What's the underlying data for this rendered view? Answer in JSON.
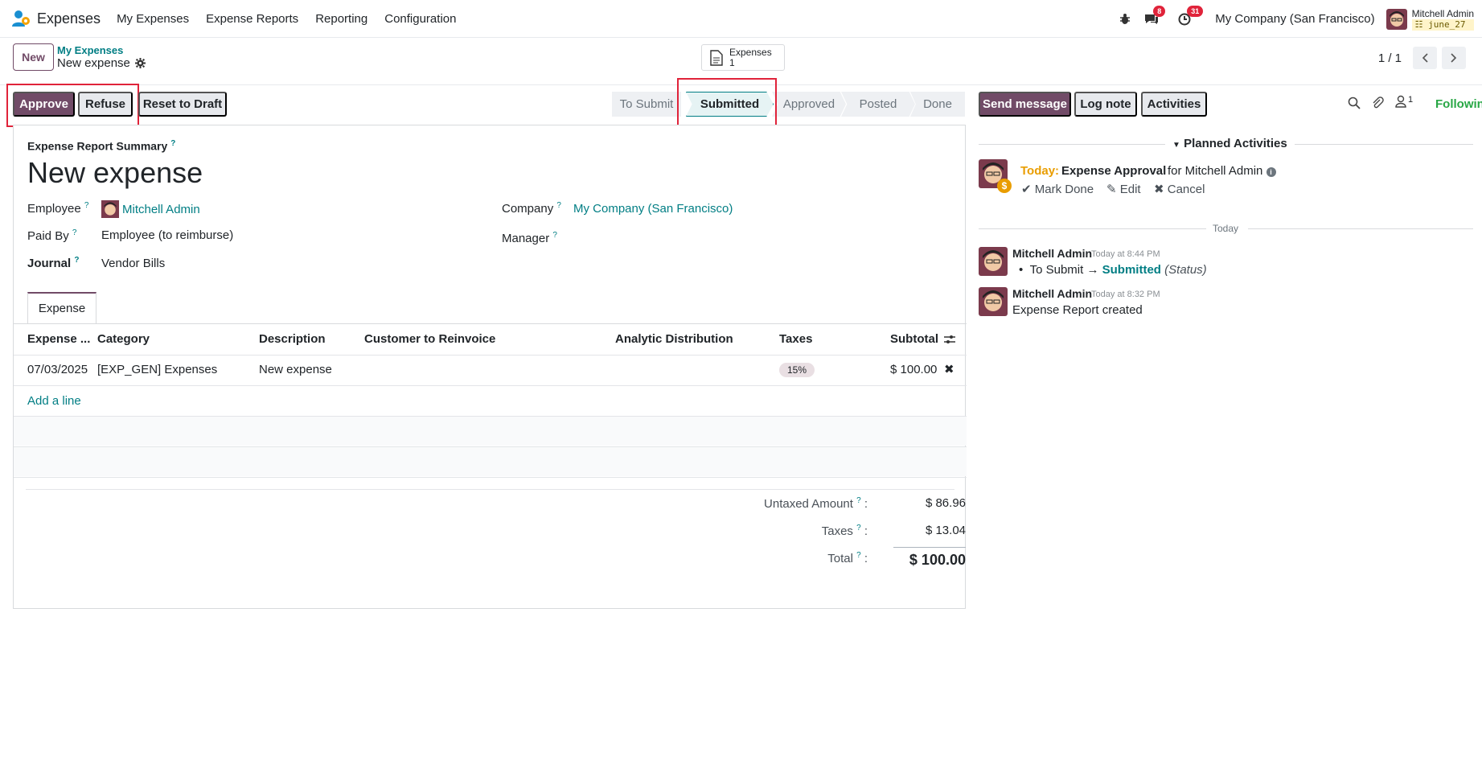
{
  "navbar": {
    "app_name": "Expenses",
    "menu": [
      "My Expenses",
      "Expense Reports",
      "Reporting",
      "Configuration"
    ],
    "messages_count": "8",
    "activities_count": "31",
    "company": "My Company (San Francisco)",
    "user_name": "Mitchell Admin",
    "database": "june_27"
  },
  "control": {
    "new_label": "New",
    "breadcrumb_parent": "My Expenses",
    "breadcrumb_current": "New expense",
    "smart_button_label": "Expenses",
    "smart_button_count": "1",
    "pager": "1 / 1"
  },
  "actions": {
    "approve": "Approve",
    "refuse": "Refuse",
    "reset": "Reset to Draft"
  },
  "statusbar": {
    "stages": [
      "To Submit",
      "Submitted",
      "Approved",
      "Posted",
      "Done"
    ],
    "active": "Submitted"
  },
  "form": {
    "summary_label": "Expense Report Summary",
    "help_marker": "?",
    "title": "New expense",
    "employee_label": "Employee",
    "employee_value": "Mitchell Admin",
    "paid_by_label": "Paid By",
    "paid_by_value": "Employee (to reimburse)",
    "journal_label": "Journal",
    "journal_value": "Vendor Bills",
    "company_label": "Company",
    "company_value": "My Company (San Francisco)",
    "manager_label": "Manager",
    "tab_label": "Expense"
  },
  "table": {
    "headers": [
      "Expense ...",
      "Category",
      "Description",
      "Customer to Reinvoice",
      "Analytic Distribution",
      "Taxes",
      "Subtotal"
    ],
    "rows": [
      {
        "date": "07/03/2025",
        "category": "[EXP_GEN] Expenses",
        "description": "New expense",
        "customer": "",
        "analytic": "",
        "taxes": "15%",
        "subtotal": "$ 100.00"
      }
    ],
    "add_line": "Add a line"
  },
  "totals": {
    "untaxed_label": "Untaxed Amount",
    "untaxed_value": "$ 86.96",
    "taxes_label": "Taxes",
    "taxes_value": "$ 13.04",
    "total_label": "Total",
    "total_value": "$ 100.00",
    "colon": ":"
  },
  "chatter": {
    "send_message": "Send message",
    "log_note": "Log note",
    "activities": "Activities",
    "followers_count": "1",
    "following": "Following",
    "planned_title": "Planned Activities",
    "activity": {
      "when": "Today:",
      "name": "Expense Approval",
      "for": "for Mitchell Admin",
      "mark_done": "Mark Done",
      "edit": "Edit",
      "cancel": "Cancel"
    },
    "separator": "Today",
    "messages": [
      {
        "author": "Mitchell Admin",
        "time": "Today at 8:44 PM",
        "from": "To Submit",
        "to": "Submitted",
        "field": "(Status)"
      },
      {
        "author": "Mitchell Admin",
        "time": "Today at 8:32 PM",
        "body": "Expense Report created"
      }
    ]
  },
  "colors": {
    "primary": "#714b67",
    "link": "#017e84",
    "highlight": "#e0233a",
    "following": "#28a745"
  }
}
